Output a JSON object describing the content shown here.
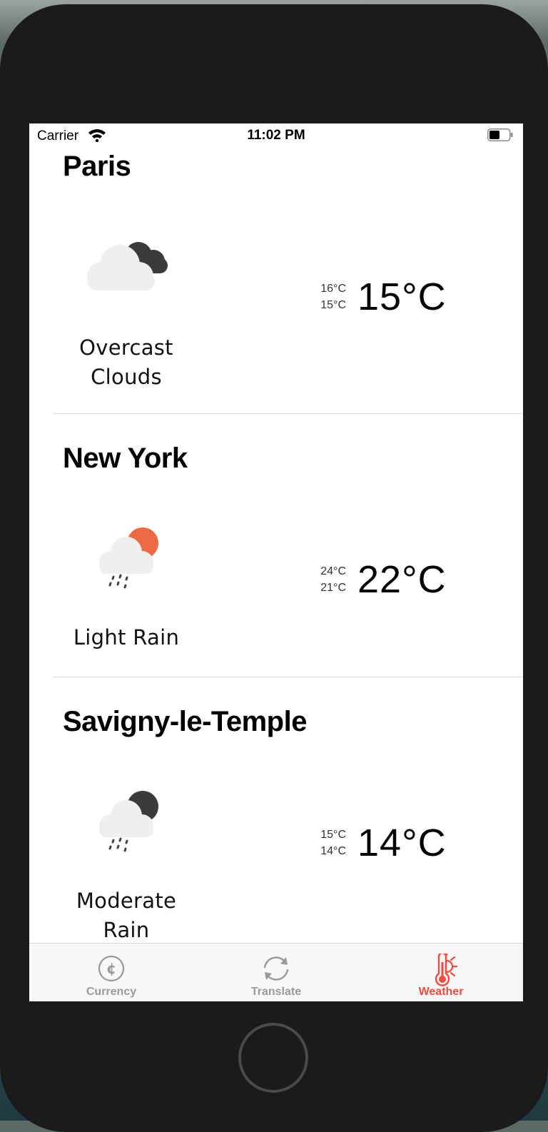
{
  "status_bar": {
    "carrier": "Carrier",
    "time": "11:02 PM"
  },
  "weather": [
    {
      "city": "Paris",
      "description_lines": [
        "Overcast",
        "Clouds"
      ],
      "temp_max": "16°C",
      "temp_min": "15°C",
      "temp": "15°C",
      "icon": "overcast-clouds-icon"
    },
    {
      "city": "New York",
      "description_lines": [
        "Light Rain"
      ],
      "temp_max": "24°C",
      "temp_min": "21°C",
      "temp": "22°C",
      "icon": "light-rain-sun-icon"
    },
    {
      "city": "Savigny-le-Temple",
      "description_lines": [
        "Moderate",
        "Rain"
      ],
      "temp_max": "15°C",
      "temp_min": "14°C",
      "temp": "14°C",
      "icon": "moderate-rain-moon-icon"
    }
  ],
  "tab_bar": {
    "tabs": [
      {
        "label": "Currency",
        "icon": "currency-icon"
      },
      {
        "label": "Translate",
        "icon": "translate-icon"
      },
      {
        "label": "Weather",
        "icon": "thermometer-sun-icon",
        "active": true
      }
    ]
  },
  "colors": {
    "accent": "#f24a3c",
    "sun": "#ee6a44",
    "dark_cloud": "#3b3b3b",
    "light_cloud": "#efefef",
    "inactive_tab": "#999999"
  }
}
